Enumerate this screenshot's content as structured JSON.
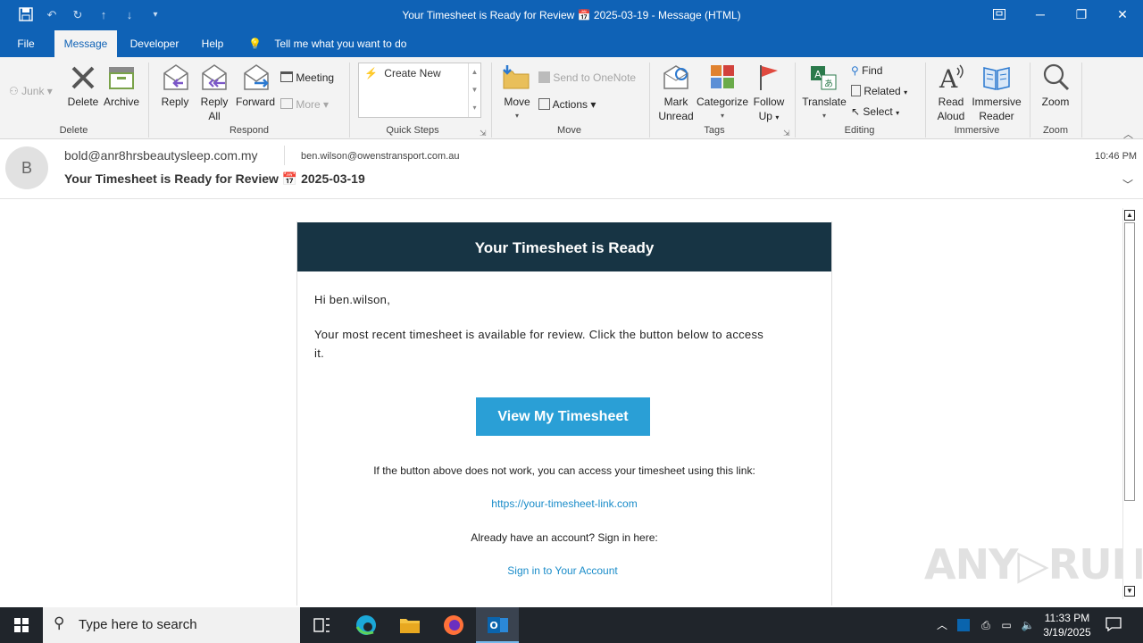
{
  "window": {
    "title": "Your Timesheet is Ready for Review 📅 2025-03-19  -  Message (HTML)"
  },
  "tabs": [
    {
      "label": "File"
    },
    {
      "label": "Message"
    },
    {
      "label": "Developer"
    },
    {
      "label": "Help"
    }
  ],
  "tell_me": "Tell me what you want to do",
  "ribbon": {
    "delete_group": {
      "junk": "Junk",
      "delete": "Delete",
      "archive": "Archive",
      "label": "Delete"
    },
    "respond_group": {
      "reply": "Reply",
      "reply_all_1": "Reply",
      "reply_all_2": "All",
      "forward": "Forward",
      "meeting": "Meeting",
      "more": "More",
      "label": "Respond"
    },
    "quick_steps": {
      "create_new": "Create New",
      "label": "Quick Steps"
    },
    "move_group": {
      "move": "Move",
      "send_onenote": "Send to OneNote",
      "actions": "Actions",
      "label": "Move"
    },
    "tags_group": {
      "mark_unread_1": "Mark",
      "mark_unread_2": "Unread",
      "categorize": "Categorize",
      "follow_up_1": "Follow",
      "follow_up_2": "Up",
      "label": "Tags"
    },
    "editing_group": {
      "translate": "Translate",
      "find": "Find",
      "related": "Related",
      "select": "Select",
      "label": "Editing"
    },
    "immersive_group": {
      "read_aloud_1": "Read",
      "read_aloud_2": "Aloud",
      "immersive_reader_1": "Immersive",
      "immersive_reader_2": "Reader",
      "label": "Immersive"
    },
    "zoom_group": {
      "zoom": "Zoom",
      "label": "Zoom"
    }
  },
  "message": {
    "avatar_initial": "B",
    "from": "bold@anr8hrsbeautysleep.com.my",
    "to": "ben.wilson@owenstransport.com.au",
    "time": "10:46 PM",
    "subject": "Your Timesheet is Ready for Review 📅 2025-03-19"
  },
  "email": {
    "banner": "Your Timesheet is Ready",
    "greeting": "Hi ben.wilson,",
    "body_line1": "Your most recent timesheet is available for review. Click the button below to access",
    "body_line2": "it.",
    "button": "View My Timesheet",
    "fallback": "If the button above does not work, you can access your timesheet using this link:",
    "link": "https://your-timesheet-link.com",
    "signin_prompt": "Already have an account? Sign in here:",
    "signin_link": "Sign in to Your Account"
  },
  "watermark": "ANY RUN",
  "taskbar": {
    "search_placeholder": "Type here to search",
    "clock_time": "11:33 PM",
    "clock_date": "3/19/2025"
  },
  "colors": {
    "title_blue": "#0f62b6",
    "banner_navy": "#173444",
    "cta_blue": "#2a9fd6",
    "link_blue": "#1a8cc9"
  }
}
